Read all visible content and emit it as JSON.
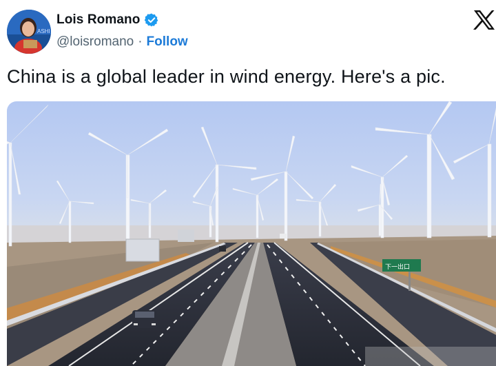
{
  "author": {
    "display_name": "Lois Romano",
    "handle": "@loisromano",
    "separator": "·",
    "follow_label": "Follow",
    "verified_color": "#1d9bf0",
    "avatar_icon": "profile-photo"
  },
  "brand": {
    "logo_icon": "x-logo-icon"
  },
  "tweet": {
    "text": "China is a global leader in wind energy. Here's a pic."
  },
  "media": {
    "description_icon": "photo",
    "road_sign_text": "下一出口"
  },
  "colors": {
    "link_blue": "#1d7bd8",
    "text_primary": "#0f1419",
    "text_secondary": "#536471"
  }
}
